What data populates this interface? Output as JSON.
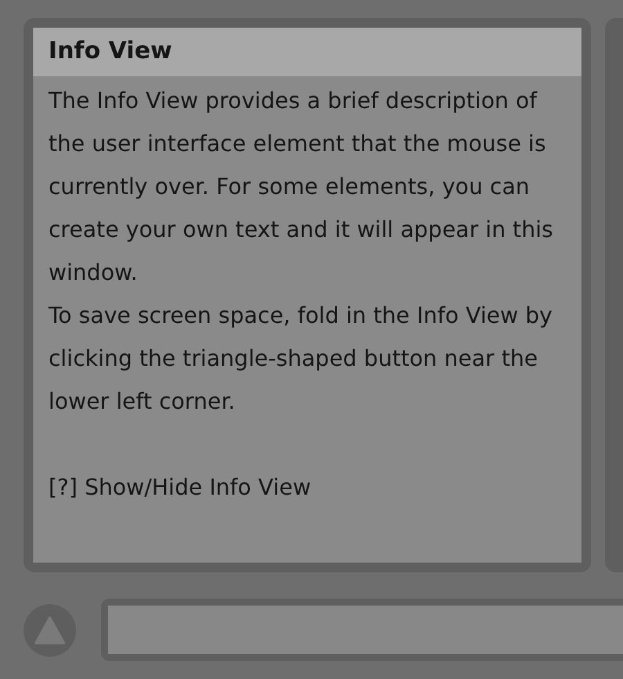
{
  "info_view": {
    "title": "Info View",
    "paragraphs": [
      "The Info View provides a brief description of the user interface element that the mouse is currently over. For some elements, you can create your own text and it will appear in this window.",
      "To save screen space, fold in the Info View by clicking the triangle-shaped button near the lower left corner."
    ],
    "shortcut": "[?] Show/Hide Info View"
  }
}
